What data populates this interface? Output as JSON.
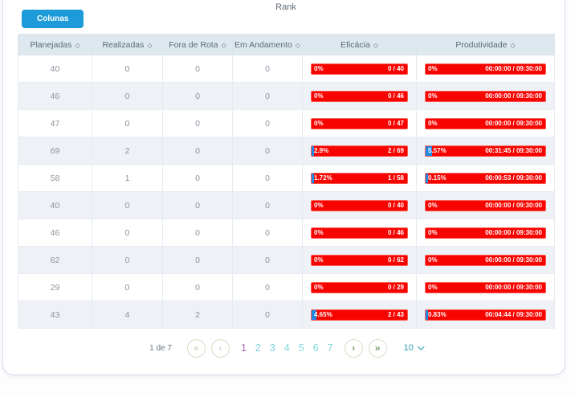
{
  "title": "Rank",
  "toolbar": {
    "colunas_label": "Colunas"
  },
  "table": {
    "sort_icon": "◇",
    "columns": [
      {
        "label": "Planejadas"
      },
      {
        "label": "Realizadas"
      },
      {
        "label": "Fora de Rota"
      },
      {
        "label": "Em Andamento"
      },
      {
        "label": "Eficácia"
      },
      {
        "label": "Produtividade"
      }
    ],
    "rows": [
      {
        "planejadas": "40",
        "realizadas": "0",
        "fora_de_rota": "0",
        "em_andamento": "0",
        "eficacia": {
          "pct_label": "0%",
          "pct": 0,
          "value": "0 / 40"
        },
        "produtividade": {
          "pct_label": "0%",
          "pct": 0,
          "value": "00:00:00 / 09:30:00"
        }
      },
      {
        "planejadas": "46",
        "realizadas": "0",
        "fora_de_rota": "0",
        "em_andamento": "0",
        "eficacia": {
          "pct_label": "0%",
          "pct": 0,
          "value": "0 / 46"
        },
        "produtividade": {
          "pct_label": "0%",
          "pct": 0,
          "value": "00:00:00 / 09:30:00"
        }
      },
      {
        "planejadas": "47",
        "realizadas": "0",
        "fora_de_rota": "0",
        "em_andamento": "0",
        "eficacia": {
          "pct_label": "0%",
          "pct": 0,
          "value": "0 / 47"
        },
        "produtividade": {
          "pct_label": "0%",
          "pct": 0,
          "value": "00:00:00 / 09:30:00"
        }
      },
      {
        "planejadas": "69",
        "realizadas": "2",
        "fora_de_rota": "0",
        "em_andamento": "0",
        "eficacia": {
          "pct_label": "2.9%",
          "pct": 2.9,
          "value": "2 / 69"
        },
        "produtividade": {
          "pct_label": "5.57%",
          "pct": 5.57,
          "value": "00:31:45 / 09:30:00"
        }
      },
      {
        "planejadas": "58",
        "realizadas": "1",
        "fora_de_rota": "0",
        "em_andamento": "0",
        "eficacia": {
          "pct_label": "1.72%",
          "pct": 1.72,
          "value": "1 / 58"
        },
        "produtividade": {
          "pct_label": "0.15%",
          "pct": 0.15,
          "value": "00:00:53 / 09:30:00"
        }
      },
      {
        "planejadas": "40",
        "realizadas": "0",
        "fora_de_rota": "0",
        "em_andamento": "0",
        "eficacia": {
          "pct_label": "0%",
          "pct": 0,
          "value": "0 / 40"
        },
        "produtividade": {
          "pct_label": "0%",
          "pct": 0,
          "value": "00:00:00 / 09:30:00"
        }
      },
      {
        "planejadas": "46",
        "realizadas": "0",
        "fora_de_rota": "0",
        "em_andamento": "0",
        "eficacia": {
          "pct_label": "0%",
          "pct": 0,
          "value": "0 / 46"
        },
        "produtividade": {
          "pct_label": "0%",
          "pct": 0,
          "value": "00:00:00 / 09:30:00"
        }
      },
      {
        "planejadas": "62",
        "realizadas": "0",
        "fora_de_rota": "0",
        "em_andamento": "0",
        "eficacia": {
          "pct_label": "0%",
          "pct": 0,
          "value": "0 / 62"
        },
        "produtividade": {
          "pct_label": "0%",
          "pct": 0,
          "value": "00:00:00 / 09:30:00"
        }
      },
      {
        "planejadas": "29",
        "realizadas": "0",
        "fora_de_rota": "0",
        "em_andamento": "0",
        "eficacia": {
          "pct_label": "0%",
          "pct": 0,
          "value": "0 / 29"
        },
        "produtividade": {
          "pct_label": "0%",
          "pct": 0,
          "value": "00:00:00 / 09:30:00"
        }
      },
      {
        "planejadas": "43",
        "realizadas": "4",
        "fora_de_rota": "2",
        "em_andamento": "0",
        "eficacia": {
          "pct_label": "4.65%",
          "pct": 4.65,
          "value": "2 / 43"
        },
        "produtividade": {
          "pct_label": "0.83%",
          "pct": 0.83,
          "value": "00:04:44 / 09:30:00"
        }
      }
    ]
  },
  "pagination": {
    "info": "1 de 7",
    "pages": [
      "1",
      "2",
      "3",
      "4",
      "5",
      "6",
      "7"
    ],
    "active_page": "1",
    "page_size": "10",
    "first_icon": "«",
    "prev_icon": "‹",
    "next_icon": "›",
    "last_icon": "»"
  },
  "colors": {
    "accent_blue": "#1d9bd9",
    "bar_red": "#f80400",
    "bar_fill_blue": "#1e88e5",
    "header_bg": "#dde9ef",
    "row_alt_bg": "#eef1f6",
    "page_active": "#a468b0",
    "page_inactive": "#7fd5de",
    "arrow_enabled": "#4e7a33",
    "arrow_disabled": "#bdc8ae"
  }
}
